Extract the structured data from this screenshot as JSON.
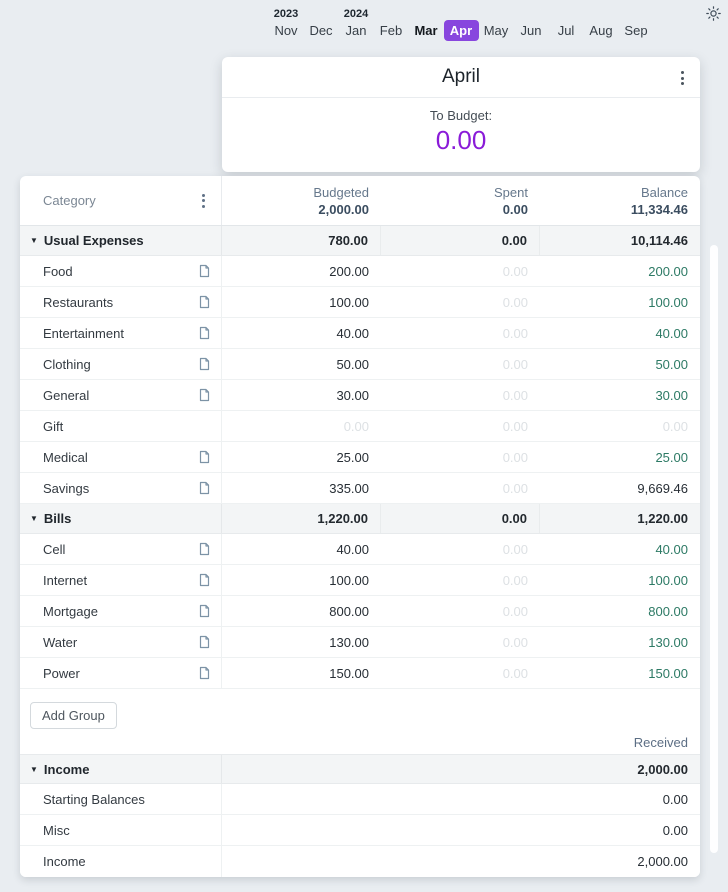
{
  "theme": {
    "selected_month_purple": "#8846de",
    "to_budget_purple": "#8a1bd8",
    "positive_green": "#2d7a65",
    "page_background": "#e9edf1"
  },
  "top_bar": {
    "theme_toggle_icon": "sun-icon"
  },
  "month_nav": {
    "years": [
      "2023",
      "2024"
    ],
    "months": [
      {
        "label": "Nov",
        "style": "normal"
      },
      {
        "label": "Dec",
        "style": "normal"
      },
      {
        "label": "Jan",
        "style": "normal"
      },
      {
        "label": "Feb",
        "style": "normal"
      },
      {
        "label": "Mar",
        "style": "bold"
      },
      {
        "label": "Apr",
        "style": "selected"
      },
      {
        "label": "May",
        "style": "normal"
      },
      {
        "label": "Jun",
        "style": "normal"
      },
      {
        "label": "Jul",
        "style": "normal"
      },
      {
        "label": "Aug",
        "style": "normal"
      },
      {
        "label": "Sep",
        "style": "normal"
      }
    ]
  },
  "month_card": {
    "title": "April",
    "menu_icon": "kebab-menu-icon",
    "to_budget_label": "To Budget:",
    "to_budget_value": "0.00"
  },
  "table": {
    "header": {
      "category_label": "Category",
      "menu_icon": "kebab-menu-icon",
      "columns": [
        {
          "label": "Budgeted",
          "total": "2,000.00"
        },
        {
          "label": "Spent",
          "total": "0.00"
        },
        {
          "label": "Balance",
          "total": "11,334.46"
        }
      ]
    },
    "expense_groups": [
      {
        "name": "Usual Expenses",
        "budgeted": "780.00",
        "spent": "0.00",
        "balance": "10,114.46",
        "rows": [
          {
            "name": "Food",
            "has_note": true,
            "budgeted": "200.00",
            "budgeted_style": "dark",
            "spent": "0.00",
            "balance": "200.00",
            "balance_style": "green"
          },
          {
            "name": "Restaurants",
            "has_note": true,
            "budgeted": "100.00",
            "budgeted_style": "dark",
            "spent": "0.00",
            "balance": "100.00",
            "balance_style": "green"
          },
          {
            "name": "Entertainment",
            "has_note": true,
            "budgeted": "40.00",
            "budgeted_style": "dark",
            "spent": "0.00",
            "balance": "40.00",
            "balance_style": "green"
          },
          {
            "name": "Clothing",
            "has_note": true,
            "budgeted": "50.00",
            "budgeted_style": "dark",
            "spent": "0.00",
            "balance": "50.00",
            "balance_style": "green"
          },
          {
            "name": "General",
            "has_note": true,
            "budgeted": "30.00",
            "budgeted_style": "dark",
            "spent": "0.00",
            "balance": "30.00",
            "balance_style": "green"
          },
          {
            "name": "Gift",
            "has_note": false,
            "budgeted": "0.00",
            "budgeted_style": "faint",
            "spent": "0.00",
            "balance": "0.00",
            "balance_style": "faint"
          },
          {
            "name": "Medical",
            "has_note": true,
            "budgeted": "25.00",
            "budgeted_style": "dark",
            "spent": "0.00",
            "balance": "25.00",
            "balance_style": "green"
          },
          {
            "name": "Savings",
            "has_note": true,
            "budgeted": "335.00",
            "budgeted_style": "dark",
            "spent": "0.00",
            "balance": "9,669.46",
            "balance_style": "dark"
          }
        ]
      },
      {
        "name": "Bills",
        "budgeted": "1,220.00",
        "spent": "0.00",
        "balance": "1,220.00",
        "rows": [
          {
            "name": "Cell",
            "has_note": true,
            "budgeted": "40.00",
            "budgeted_style": "dark",
            "spent": "0.00",
            "balance": "40.00",
            "balance_style": "green"
          },
          {
            "name": "Internet",
            "has_note": true,
            "budgeted": "100.00",
            "budgeted_style": "dark",
            "spent": "0.00",
            "balance": "100.00",
            "balance_style": "green"
          },
          {
            "name": "Mortgage",
            "has_note": true,
            "budgeted": "800.00",
            "budgeted_style": "dark",
            "spent": "0.00",
            "balance": "800.00",
            "balance_style": "green"
          },
          {
            "name": "Water",
            "has_note": true,
            "budgeted": "130.00",
            "budgeted_style": "dark",
            "spent": "0.00",
            "balance": "130.00",
            "balance_style": "green"
          },
          {
            "name": "Power",
            "has_note": true,
            "budgeted": "150.00",
            "budgeted_style": "dark",
            "spent": "0.00",
            "balance": "150.00",
            "balance_style": "green"
          }
        ]
      }
    ],
    "add_group_label": "Add Group",
    "received_label": "Received",
    "income_group": {
      "name": "Income",
      "received": "2,000.00",
      "rows": [
        {
          "name": "Starting Balances",
          "received": "0.00"
        },
        {
          "name": "Misc",
          "received": "0.00"
        },
        {
          "name": "Income",
          "received": "2,000.00"
        }
      ]
    }
  }
}
